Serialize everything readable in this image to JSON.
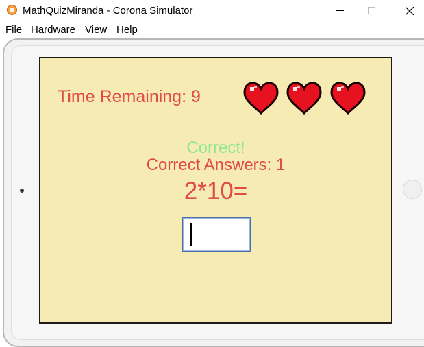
{
  "window": {
    "title": "MathQuizMiranda - Corona Simulator",
    "icon": "corona-simulator-icon",
    "controls": [
      "minimize-icon",
      "maximize-icon",
      "close-icon"
    ]
  },
  "menu": {
    "items": [
      {
        "label": "File"
      },
      {
        "label": "Hardware"
      },
      {
        "label": "View"
      },
      {
        "label": "Help"
      }
    ]
  },
  "game": {
    "time_label": "Time Remaining: 9",
    "lives": 3,
    "heart_icon": "heart-icon",
    "feedback": "Correct!",
    "correct_answers_label": "Correct Answers: 1",
    "question": "2*10=",
    "answer_value": ""
  },
  "colors": {
    "screen_background": "#f6ebb3",
    "label_red": "#e04a4a",
    "feedback_green": "#8fe88f",
    "heart_red": "#e6121f",
    "accent_orange": "#f6a13b"
  }
}
